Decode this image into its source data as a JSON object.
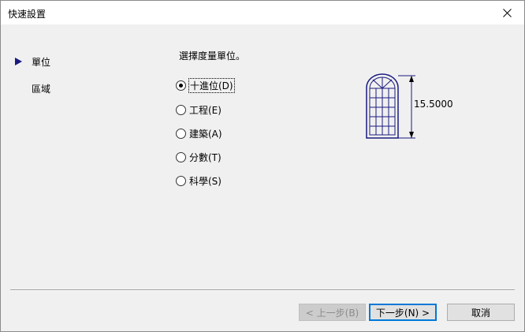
{
  "window": {
    "title": "快速設置"
  },
  "nav": {
    "items": [
      {
        "label": "單位",
        "active": true
      },
      {
        "label": "區域",
        "active": false
      }
    ]
  },
  "main": {
    "prompt": "選擇度量單位。",
    "options": [
      {
        "label": "十進位(D)",
        "checked": true,
        "focused": true
      },
      {
        "label": "工程(E)",
        "checked": false
      },
      {
        "label": "建築(A)",
        "checked": false
      },
      {
        "label": "分數(T)",
        "checked": false
      },
      {
        "label": "科學(S)",
        "checked": false
      }
    ],
    "preview_value": "15.5000"
  },
  "buttons": {
    "back": "< 上一步(B)",
    "next": "下一步(N) >",
    "cancel": "取消"
  },
  "colors": {
    "accent": "#0078d7",
    "nav_arrow": "#1a1a80",
    "illustration": "#1a1a80"
  }
}
